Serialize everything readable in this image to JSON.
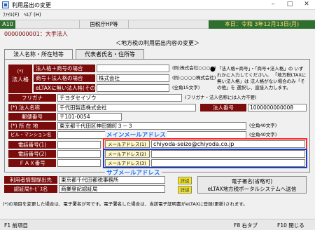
{
  "window": {
    "title": "利用届出の変更",
    "min": "–",
    "max": "□",
    "close": "✕"
  },
  "menu": {
    "file": "ﾌｧｲﾙ(F)",
    "help": "ﾍﾙﾌﾟ(H)"
  },
  "strip": {
    "code": "A10",
    "office": "国税庁HP等",
    "date": "本日：令和 3年12月13日(月)"
  },
  "org": {
    "label": "0000000001：大手法人"
  },
  "panel_title": "＜地方税の利用届出内容の変更＞",
  "tabs": [
    "法人名称・所在地等",
    "代表者氏名・住所等"
  ],
  "corp_section": {
    "side_label": "法人格",
    "side_star": "(*)",
    "rows": [
      {
        "label": "法人格＋商号の場合",
        "value": "",
        "example": "(例:株式会社○○○○)"
      },
      {
        "label": "商号＋法人格の場合",
        "value": "株式会社",
        "example": "(例:○○○○株式会社)"
      },
      {
        "label": "eLTAXに無い法人格(その他)",
        "value": "",
        "example": "(全角15文字)"
      }
    ],
    "right_note": "「法人格+商号」・「商号+法人格」の いずれかに入力してください。 「地方税LTAXに無い法人格」は 法人格がない場合のみ「その他」を 選択し、直接入力します。",
    "right_bullet": "●"
  },
  "furigana": {
    "label": "フリガナ",
    "value": "チヨダセイゾウ",
    "note": "(フリガナ・法人名称には入力不要)"
  },
  "corp_name": {
    "label": "(*) 法人名称",
    "value": "千代田製造株式会社"
  },
  "corp_no": {
    "label": "法人番号",
    "value": "1000000000008"
  },
  "postal": {
    "label": "郵便番号",
    "value": "〒101-0054"
  },
  "address": {
    "label": "(*) 所 在 地",
    "value": "東京都千代田区神田錦町３－３",
    "note": "(全角40文字)"
  },
  "building": {
    "label": "ビル・マンション名",
    "value": "",
    "note": "(全角40文字)"
  },
  "main_annotation": "メインメールアドレス",
  "sub_annotation": "サブメールアドレス",
  "phones": [
    {
      "label": "電話番号(1)",
      "value": "",
      "mail_label": "メールアドレス(1)",
      "mail": "chiyoda-seizo@chiyoda.co.jp"
    },
    {
      "label": "電話番号(2)",
      "value": "",
      "mail_label": "メールアドレス(2)",
      "mail": ""
    },
    {
      "label": "ＦＡＸ番号",
      "value": "",
      "mail_label": "メールアドレス(3)",
      "mail": ""
    }
  ],
  "bottom": {
    "info_label": "利用者情報提出先",
    "info_value": "東京都千代田都税事務所",
    "cert_label": "認証局ｻｰﾋﾞｽ名",
    "cert_value": "商業登記認証局",
    "detail": "詳説",
    "send_line1": "電子署名(省略可)",
    "send_line2": "eLTAX地方税ポータルシステムへ送信"
  },
  "footnote": "(*)の項目を変更した場合は、電子署名が可です。電子署名した場合は、当該電子証明書がeLTAXに登録(更新)されます。",
  "fkeys": {
    "f1": "F1 前項目",
    "f8": "F8 右タブ",
    "f10": "F10 閉じる"
  },
  "colors": {
    "label_bg": "#7a0c0c",
    "header_green": "#2f6e2f",
    "date_yellow": "#f7e27a",
    "annotation_blue": "#1874ff",
    "red_box": "#ff2a2a",
    "blue_box": "#1a3dc9"
  }
}
